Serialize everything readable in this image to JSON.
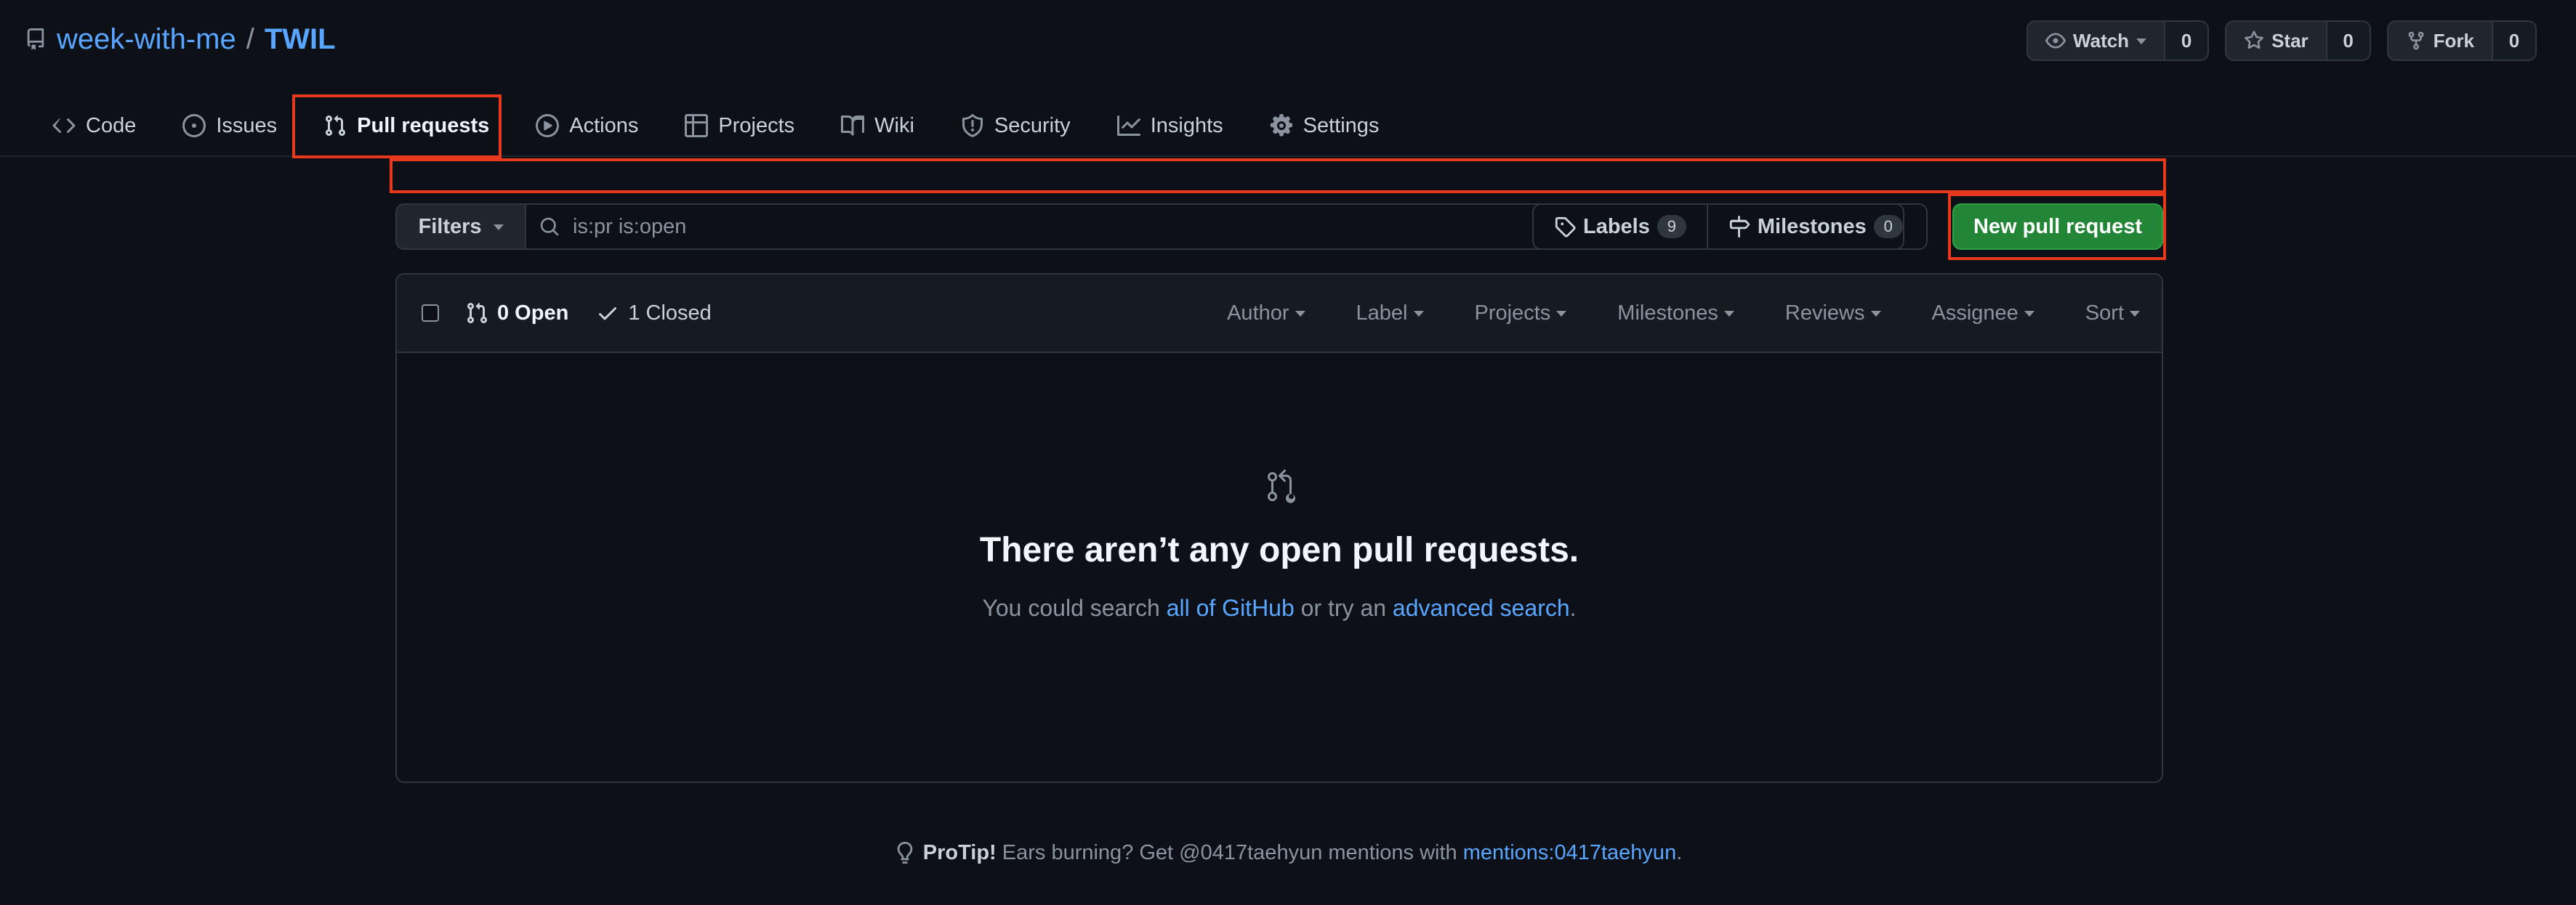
{
  "repo": {
    "owner": "week-with-me",
    "separator": "/",
    "name": "TWIL"
  },
  "actions": {
    "watch": {
      "label": "Watch",
      "count": "0"
    },
    "star": {
      "label": "Star",
      "count": "0"
    },
    "fork": {
      "label": "Fork",
      "count": "0"
    }
  },
  "nav": {
    "tabs": [
      {
        "label": "Code",
        "icon": "code-icon"
      },
      {
        "label": "Issues",
        "icon": "issue-opened-icon"
      },
      {
        "label": "Pull requests",
        "icon": "git-pull-request-icon",
        "active": true
      },
      {
        "label": "Actions",
        "icon": "play-icon"
      },
      {
        "label": "Projects",
        "icon": "table-icon"
      },
      {
        "label": "Wiki",
        "icon": "book-icon"
      },
      {
        "label": "Security",
        "icon": "shield-icon"
      },
      {
        "label": "Insights",
        "icon": "graph-icon"
      },
      {
        "label": "Settings",
        "icon": "gear-icon"
      }
    ]
  },
  "filters": {
    "filters_label": "Filters",
    "search_value": "is:pr is:open",
    "labels": {
      "label": "Labels",
      "count": "9"
    },
    "milestones": {
      "label": "Milestones",
      "count": "0"
    },
    "new_pr_label": "New pull request"
  },
  "list": {
    "open_label": "0 Open",
    "closed_label": "1 Closed",
    "menus": [
      "Author",
      "Label",
      "Projects",
      "Milestones",
      "Reviews",
      "Assignee",
      "Sort"
    ]
  },
  "empty": {
    "title": "There aren’t any open pull requests.",
    "text_prefix": "You could search ",
    "link_1": "all of GitHub",
    "text_middle": " or try an ",
    "link_2": "advanced search",
    "text_suffix": "."
  },
  "protip": {
    "strong": "ProTip!",
    "text": " Ears burning? Get @0417taehyun mentions with ",
    "link": "mentions:0417taehyun",
    "suffix": "."
  },
  "colors": {
    "background": "#0d1117",
    "link": "#58a6ff",
    "primary_button": "#238636",
    "annotation_border": "#e8391d"
  }
}
